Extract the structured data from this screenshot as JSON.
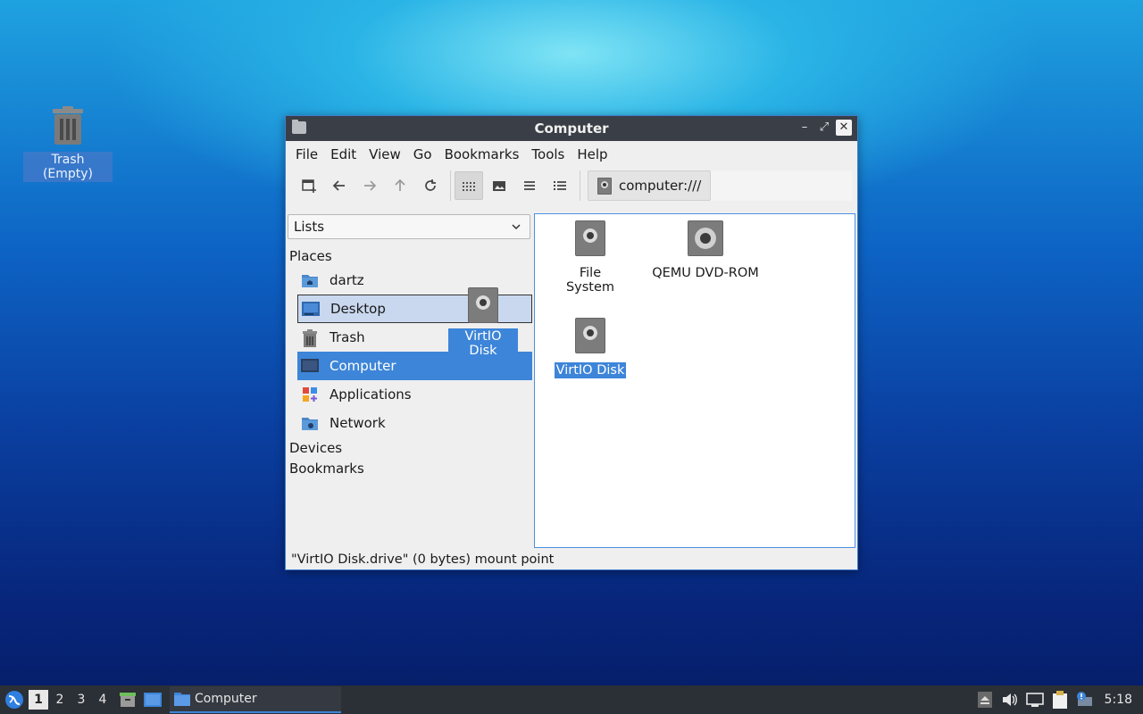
{
  "desktop": {
    "trash_label": "Trash (Empty)"
  },
  "window": {
    "title": "Computer",
    "controls": {
      "minimize": "–",
      "maximize": "⤢",
      "close": "✕"
    }
  },
  "menubar": [
    "File",
    "Edit",
    "View",
    "Go",
    "Bookmarks",
    "Tools",
    "Help"
  ],
  "toolbar": {
    "location": "computer:///"
  },
  "sidebar": {
    "select_value": "Lists",
    "places_heading": "Places",
    "places": [
      "dartz",
      "Desktop",
      "Trash",
      "Computer",
      "Applications",
      "Network"
    ],
    "devices_heading": "Devices",
    "bookmarks_heading": "Bookmarks"
  },
  "files": [
    {
      "name": "File System",
      "icon": "disk-icon"
    },
    {
      "name": "QEMU DVD-ROM",
      "icon": "cdrom-icon"
    },
    {
      "name": "VirtIO Disk",
      "icon": "disk-icon"
    }
  ],
  "drag_ghost_label": "VirtIO Disk",
  "statusbar": "\"VirtIO Disk.drive\" (0 bytes) mount point",
  "taskbar": {
    "workspaces": [
      "1",
      "2",
      "3",
      "4"
    ],
    "task_title": "Computer",
    "clock": "5:18"
  },
  "colors": {
    "selection": "#3d85d8",
    "titlebar": "#3a3f47",
    "taskbar": "#2b2f36"
  }
}
